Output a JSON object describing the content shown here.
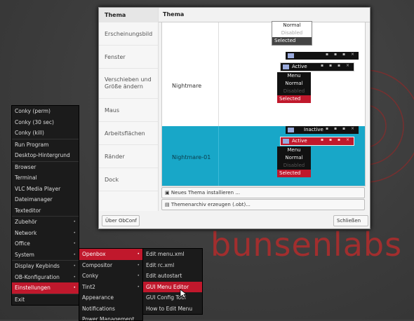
{
  "desktop": {
    "brand": "bunsenlabs"
  },
  "obconf": {
    "header": "Thema",
    "sidebar": [
      "Thema",
      "Erscheinungsbild",
      "Fenster",
      "Verschieben und Größe ändern",
      "Maus",
      "Arbeitsflächen",
      "Ränder",
      "Dock"
    ],
    "themes": [
      "Nightmare",
      "Nightmare-01"
    ],
    "install_button": "Neues Thema installieren ...",
    "archive_button": "Themenarchiv erzeugen (.obt)...",
    "about_button": "Über ObConf",
    "close_button": "Schließen",
    "preview": {
      "inactive": "Inactive",
      "active": "Active",
      "menu_items": [
        "Menu",
        "Normal",
        "Disabled",
        "Selected"
      ],
      "partial_items": [
        "Normal",
        "Disabled",
        "Selected"
      ]
    }
  },
  "root_menu": {
    "items": [
      "Conky (perm)",
      "Conky (30 sec)",
      "Conky (kill)",
      "Run Program",
      "Desktop-Hintergrund",
      "Browser",
      "Terminal",
      "VLC Media Player",
      "Dateimanager",
      "Texteditor",
      "Zubehör",
      "Network",
      "Office",
      "System",
      "Display Keybinds",
      "OB-Konfiguration",
      "Einstellungen",
      "Exit"
    ]
  },
  "submenu_einstellungen": {
    "items": [
      "Openbox",
      "Compositor",
      "Conky",
      "Tint2",
      "Appearance",
      "Notifications",
      "Power Management"
    ]
  },
  "submenu_openbox": {
    "items": [
      "Edit menu.xml",
      "Edit rc.xml",
      "Edit autostart",
      "GUI Menu Editor",
      "GUI Config Tool",
      "How to Edit Menu"
    ]
  },
  "colors": {
    "accent": "#c0182c",
    "selection": "#18a7c8"
  }
}
